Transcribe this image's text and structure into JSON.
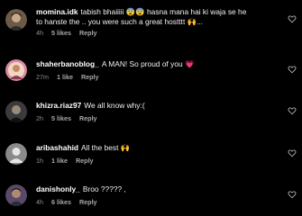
{
  "comments": [
    {
      "username": "momina.idk",
      "text_line1": "tabish bhaiiiii 😨😨 hasna mana hai ki waja se he",
      "text_line2": "to hanste the .. you were such a great hostttt 🙌...",
      "time": "4h",
      "likes": "5 likes",
      "reply": "Reply"
    },
    {
      "username": "shaherbanoblog_",
      "text_line1": "A MAN! So proud of you 💗",
      "time": "27m",
      "likes": "1 like",
      "reply": "Reply"
    },
    {
      "username": "khizra.riaz97",
      "text_line1": "We all know why:(",
      "time": "2h",
      "likes": "5 likes",
      "reply": "Reply"
    },
    {
      "username": "aribashahid",
      "text_line1": "All the best 🙌",
      "time": "1h",
      "likes": "1 like",
      "reply": "Reply"
    },
    {
      "username": "danishonly_",
      "text_line1": "Broo ????? ,",
      "time": "4h",
      "likes": "6 likes",
      "reply": "Reply"
    }
  ],
  "icons": {
    "like": "heart-outline-icon"
  },
  "colors": {
    "background": "#000000",
    "text": "#f5f5f5",
    "meta": "#8e8e8e",
    "heart_emoji": "#ff4d8d"
  }
}
